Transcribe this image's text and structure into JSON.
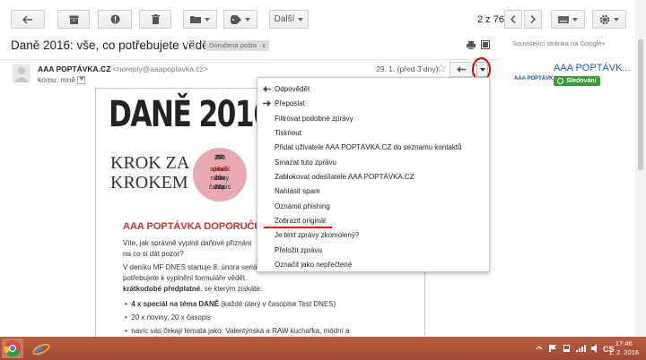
{
  "toolbar": {
    "more_label": "Další",
    "pager_text": "2 z 76"
  },
  "email": {
    "subject": "Daně 2016: vše, co potřebujete vědět",
    "label_chip": "Doručená pošta",
    "label_chip_close": "x",
    "sender_name": "AAA POPTÁVKA.CZ",
    "sender_email": "<noreply@aaapoptavka.cz>",
    "to_label": "komu: mně",
    "date": "29. 1. (před 3 dny)"
  },
  "body": {
    "headline": "DANĚ 2016",
    "krok1": "KROK ZA",
    "krok2": "KROKEM",
    "circle_price": "250",
    "circle_currency": "Kč",
    "circle_l1_num": "4x",
    "circle_l1": "speciál",
    "circle_l1_b": "daně",
    "circle_l2_num": "20x",
    "circle_l2": "noviny",
    "circle_l3_num": "20x",
    "circle_l3": "časopis",
    "heading": "AAA POPTÁVKA DOPORUČUJE",
    "p1_line1": "Víte, jak správně vyplnit daňové přiznání",
    "p1_line2": "na co si dát pozor?",
    "p2_line1": "V deníku MF DNES startuje 8. února seriá",
    "p2_line2": "potřebujete k vyplnění formuláře vědět.",
    "p2_line3_b": "krátkodobé předplatné",
    "p2_line3": ", se kterým získáte:",
    "bullet1_b": "4 x speciál na téma DANĚ",
    "bullet1": " (každé úterý v časopise Test DNES)",
    "bullet2": "20 x noviny, 20 x časopis",
    "bullet3": "navíc vás čekají témata jako: Valentýnská a RAW kuchařka, módní a"
  },
  "sidebar": {
    "related": "Související stránka na Google+",
    "logo_text": "AAA POPTÁVKA",
    "page_name": "AAA POPTÁVK...",
    "follow_label": "Sledování"
  },
  "menu": {
    "items": [
      "Odpovědět",
      "Přeposlat",
      "Filtrovat podobné zprávy",
      "Tisknout",
      "Přidat uživatele AAA POPTÁVKA.CZ do seznamu kontaktů",
      "Smazat tuto zprávu",
      "Zablokovat odesílatele AAA POPTÁVKA.CZ",
      "Nahlásit spam",
      "Oznámit phishing",
      "Zobrazit originál",
      "Je text zprávy zkomolený?",
      "Přeložit zprávu",
      "Označit jako nepřečtené"
    ]
  },
  "taskbar": {
    "time": "17:46",
    "date": "1. 2. 2016"
  },
  "colors": {
    "highlight": "#dd0000",
    "follow_green": "#3b9a3a",
    "taskbar": "#a14a32",
    "heading_red": "#c0392b"
  }
}
